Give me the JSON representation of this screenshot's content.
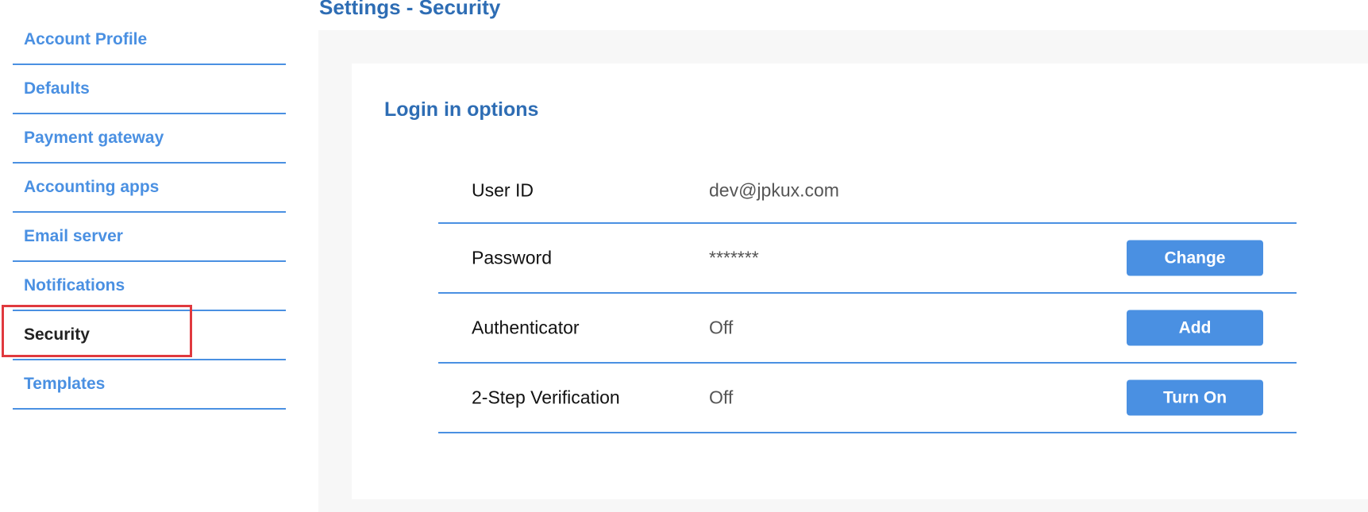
{
  "page_title": "Settings - Security",
  "sidebar": {
    "items": [
      {
        "label": "Account Profile"
      },
      {
        "label": "Defaults"
      },
      {
        "label": "Payment gateway"
      },
      {
        "label": "Accounting apps"
      },
      {
        "label": "Email server"
      },
      {
        "label": "Notifications"
      },
      {
        "label": "Security",
        "active": true
      },
      {
        "label": "Templates"
      }
    ]
  },
  "section": {
    "title": "Login in options",
    "rows": [
      {
        "label": "User ID",
        "value": "dev@jpkux.com"
      },
      {
        "label": "Password",
        "value": "*******",
        "action": "Change"
      },
      {
        "label": "Authenticator",
        "value": "Off",
        "action": "Add"
      },
      {
        "label": "2-Step Verification",
        "value": "Off",
        "action": "Turn On"
      }
    ]
  },
  "colors": {
    "accent": "#4a90e2",
    "heading": "#2e6db4",
    "highlight": "#e0393e"
  }
}
